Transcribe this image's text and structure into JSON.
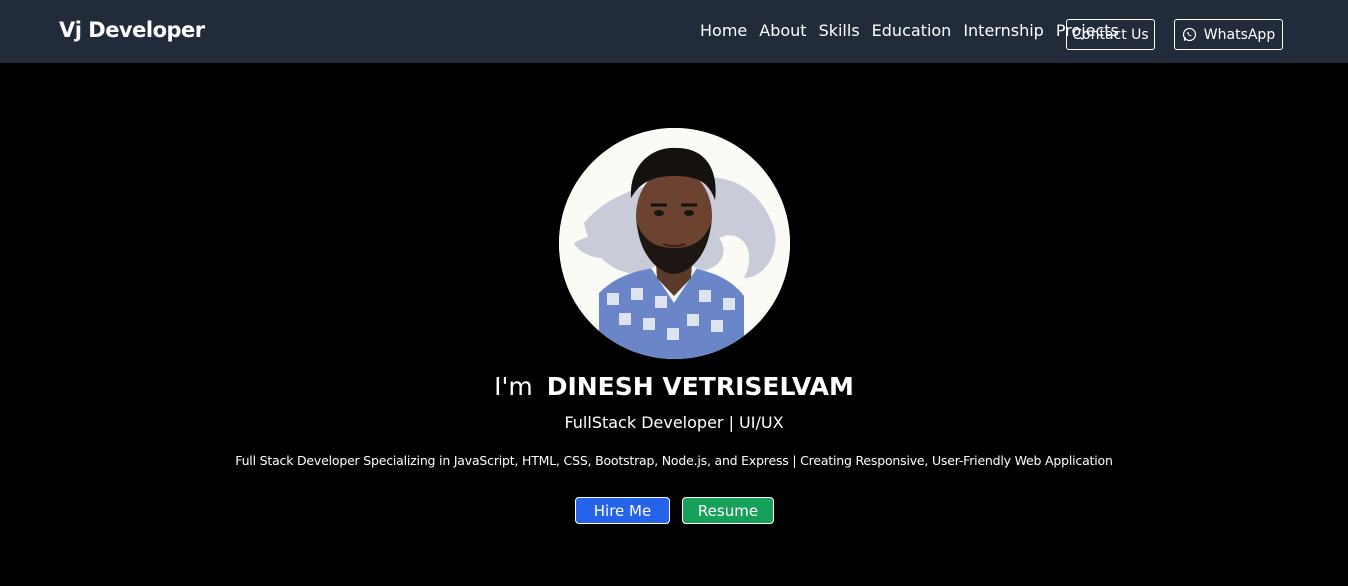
{
  "navbar": {
    "brand": "Vj Developer",
    "links": [
      "Home",
      "About",
      "Skills",
      "Education",
      "Internship",
      "Projects"
    ],
    "contact_label": "Contact Us",
    "whatsapp_label": "WhatsApp",
    "whatsapp_icon": "whatsapp-icon",
    "background": "#212b3a"
  },
  "hero": {
    "intro_prefix": "I'm",
    "name": "DINESH VETRISELVAM",
    "role": "FullStack Developer | UI/UX",
    "tagline": "Full Stack Developer Specializing in JavaScript, HTML, CSS, Bootstrap, Node.js, and Express | Creating Responsive, User-Friendly Web Application",
    "hire_label": "Hire Me",
    "resume_label": "Resume",
    "hire_color": "#2563eb",
    "resume_color": "#16a05a"
  }
}
